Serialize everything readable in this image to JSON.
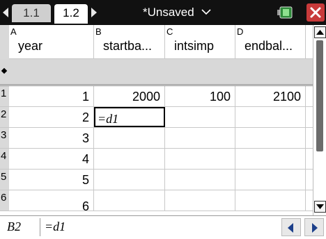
{
  "tabs": [
    {
      "label": "1.1",
      "active": false
    },
    {
      "label": "1.2",
      "active": true
    }
  ],
  "document_title": "*Unsaved",
  "columns": [
    {
      "letter": "A",
      "name": "year"
    },
    {
      "letter": "B",
      "name": "startba..."
    },
    {
      "letter": "C",
      "name": "intsimp"
    },
    {
      "letter": "D",
      "name": "endbal..."
    }
  ],
  "rows": [
    {
      "num": "1",
      "cells": [
        "1",
        "2000",
        "100",
        "2100"
      ]
    },
    {
      "num": "2",
      "cells": [
        "2",
        "=d1",
        "",
        ""
      ]
    },
    {
      "num": "3",
      "cells": [
        "3",
        "",
        "",
        ""
      ]
    },
    {
      "num": "4",
      "cells": [
        "4",
        "",
        "",
        ""
      ]
    },
    {
      "num": "5",
      "cells": [
        "5",
        "",
        "",
        ""
      ]
    },
    {
      "num": "6",
      "cells": [
        "6",
        "",
        "",
        ""
      ]
    }
  ],
  "status": {
    "cell_ref": "B2",
    "formula": "=d1"
  },
  "colors": {
    "title_bar": "#111111",
    "close_button": "#c83a3a",
    "nav_arrow": "#1c3f8a"
  }
}
